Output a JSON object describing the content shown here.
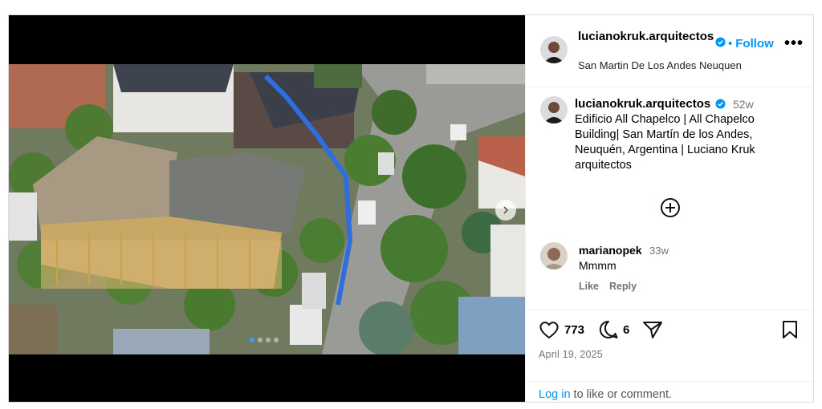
{
  "post": {
    "username": "lucianokruk.arquitectos",
    "follow_label": "Follow",
    "separator": "•",
    "more_label": "•••",
    "location": "San Martin De Los Andes Neuquen"
  },
  "caption": {
    "username": "lucianokruk.arquitectos",
    "time": "52w",
    "text": "Edificio All Chapelco | All Chapelco Building| San Martín de los Andes, Neuquén, Argentina | Luciano Kruk arquitectos"
  },
  "comment": {
    "username": "marianopek",
    "time": "33w",
    "text": "Mmmm",
    "like_label": "Like",
    "reply_label": "Reply"
  },
  "actions": {
    "likes": "773",
    "comments": "6",
    "date": "April 19, 2025"
  },
  "login": {
    "link_label": "Log in",
    "rest": " to like or comment."
  },
  "colors": {
    "accent": "#0095f6",
    "muted": "#737373",
    "carousel_active_dot": "#3aa0ff"
  },
  "icons": [
    "verified-badge-icon",
    "more-icon",
    "add-comment-icon",
    "heart-icon",
    "comment-icon",
    "share-icon",
    "bookmark-icon",
    "next-arrow-icon"
  ]
}
